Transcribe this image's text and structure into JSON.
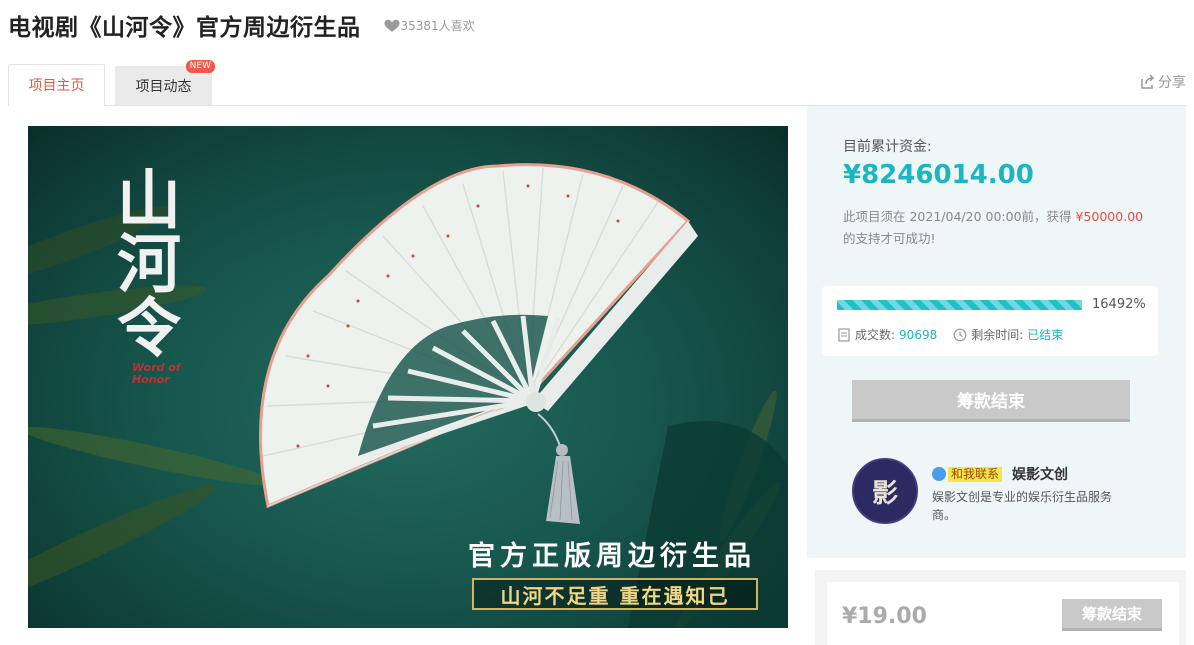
{
  "header": {
    "title": "电视剧《山河令》官方周边衍生品",
    "likes": "35381人喜欢"
  },
  "tabs": [
    {
      "label": "项目主页",
      "active": true
    },
    {
      "label": "项目动态",
      "badge": "NEW"
    }
  ],
  "share_label": "分享",
  "hero": {
    "vertical_title": "山河令",
    "tag": "Word of Honor",
    "slogan_main": "官方正版周边衍生品",
    "slogan_sub": "山河不足重  重在遇知己"
  },
  "funding": {
    "label": "目前累计资金:",
    "amount": "¥8246014.00",
    "note_prefix": "此项目须在 2021/04/20 00:00前，获得 ",
    "goal": "¥50000.00",
    "note_suffix": "的支持才可成功!",
    "progress_percent": "16492%",
    "progress_fraction": 1.0,
    "deals_label": "成交数:",
    "deals_value": "90698",
    "remaining_label": "剩余时间:",
    "remaining_value": "已结束",
    "end_button": "筹款结束"
  },
  "creator": {
    "avatar_char": "影",
    "contact_label": "和我联系",
    "name": "娱影文创",
    "description": "娱影文创是专业的娱乐衍生品服务商。"
  },
  "reward": {
    "price": "¥19.00",
    "button": "筹款结束"
  },
  "colors": {
    "accent": "#1ab6c2",
    "tab_active": "#e9573f",
    "goal_red": "#e54d42"
  }
}
